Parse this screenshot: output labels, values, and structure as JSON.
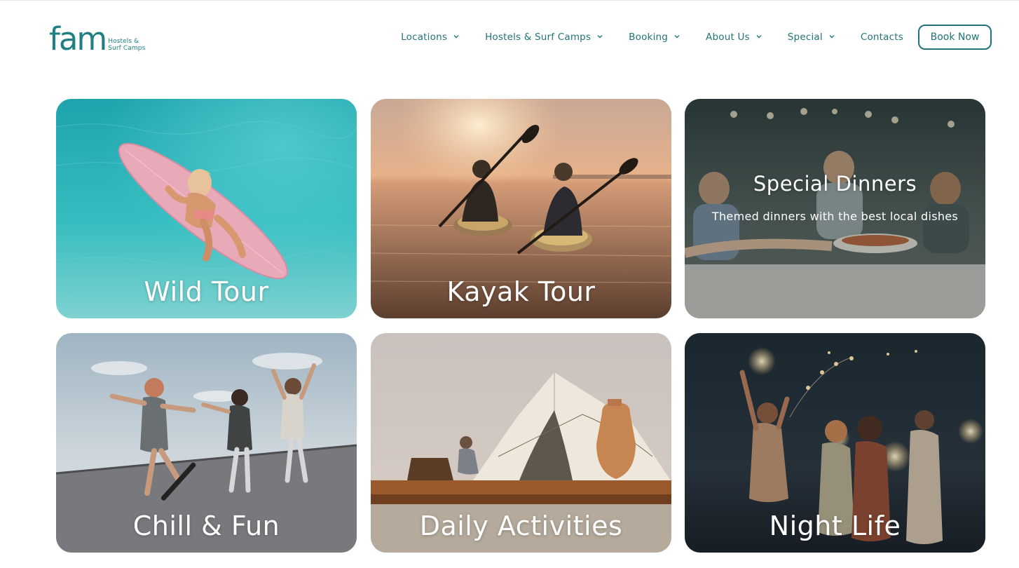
{
  "header": {
    "logo": {
      "word": "fam",
      "sub_line1": "Hostels &",
      "sub_line2": "Surf Camps"
    },
    "nav": [
      {
        "label": "Locations",
        "has_dropdown": true
      },
      {
        "label": "Hostels & Surf Camps",
        "has_dropdown": true
      },
      {
        "label": "Booking",
        "has_dropdown": true
      },
      {
        "label": "About Us",
        "has_dropdown": true
      },
      {
        "label": "Special",
        "has_dropdown": true
      },
      {
        "label": "Contacts",
        "has_dropdown": false
      }
    ],
    "cta": "Book Now"
  },
  "cards": [
    {
      "title": "Wild Tour",
      "image": "woman-on-surfboard-in-turquoise-water"
    },
    {
      "title": "Kayak Tour",
      "image": "kayakers-at-sunset"
    },
    {
      "title": "Special Dinners",
      "description": "Themed dinners with the best local dishes",
      "image": "friends-sharing-dinner-table"
    },
    {
      "title": "Chill & Fun",
      "image": "friends-skateboarding"
    },
    {
      "title": "Daily Activities",
      "image": "glamping-tent-on-deck"
    },
    {
      "title": "Night Life",
      "image": "party-with-sparklers"
    }
  ],
  "colors": {
    "brand": "#1f7479",
    "logo": "#1f7f82",
    "card_text": "#ffffff"
  }
}
